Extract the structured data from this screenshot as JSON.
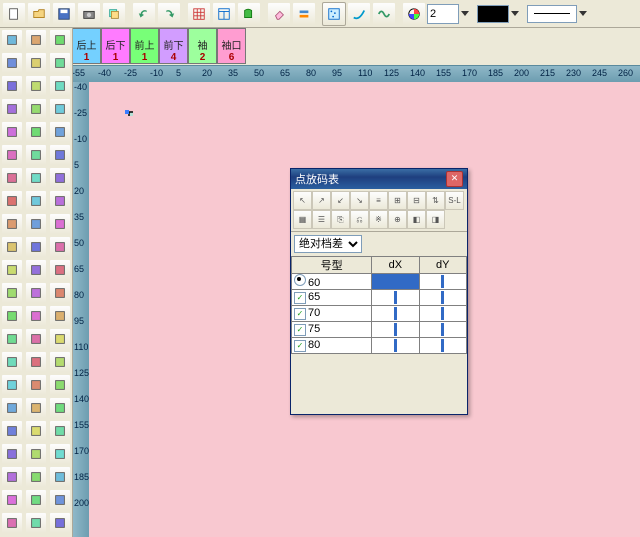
{
  "toolbar_value": "2",
  "pattern_tabs": [
    {
      "label": "后上",
      "num": "1",
      "color": "#74d0ff"
    },
    {
      "label": "后下",
      "num": "1",
      "color": "#ff7bff"
    },
    {
      "label": "前上",
      "num": "1",
      "color": "#78ff78"
    },
    {
      "label": "前下",
      "num": "4",
      "color": "#d29dff"
    },
    {
      "label": "袖",
      "num": "2",
      "color": "#9dff9d"
    },
    {
      "label": "袖口",
      "num": "6",
      "color": "#ff9dd1"
    }
  ],
  "ruler_h": [
    -55,
    -40,
    -25,
    -10,
    5,
    20,
    35,
    50,
    65,
    80,
    95,
    110,
    125,
    140,
    155,
    170,
    185,
    200,
    215,
    230,
    245,
    260
  ],
  "ruler_v": [
    -40,
    -25,
    -10,
    5,
    20,
    35,
    50,
    65,
    80,
    95,
    110,
    125,
    140,
    155,
    170,
    185,
    200
  ],
  "dialog": {
    "title": "点放码表",
    "mode_label": "绝对档差",
    "headers": [
      "号型",
      "dX",
      "dY"
    ],
    "rows": [
      {
        "kind": "radio",
        "checked": true,
        "size": "60",
        "hl": true
      },
      {
        "kind": "check",
        "checked": true,
        "size": "65"
      },
      {
        "kind": "check",
        "checked": true,
        "size": "70"
      },
      {
        "kind": "check",
        "checked": true,
        "size": "75"
      },
      {
        "kind": "check",
        "checked": true,
        "size": "80"
      }
    ],
    "sl_label": "S-L"
  }
}
